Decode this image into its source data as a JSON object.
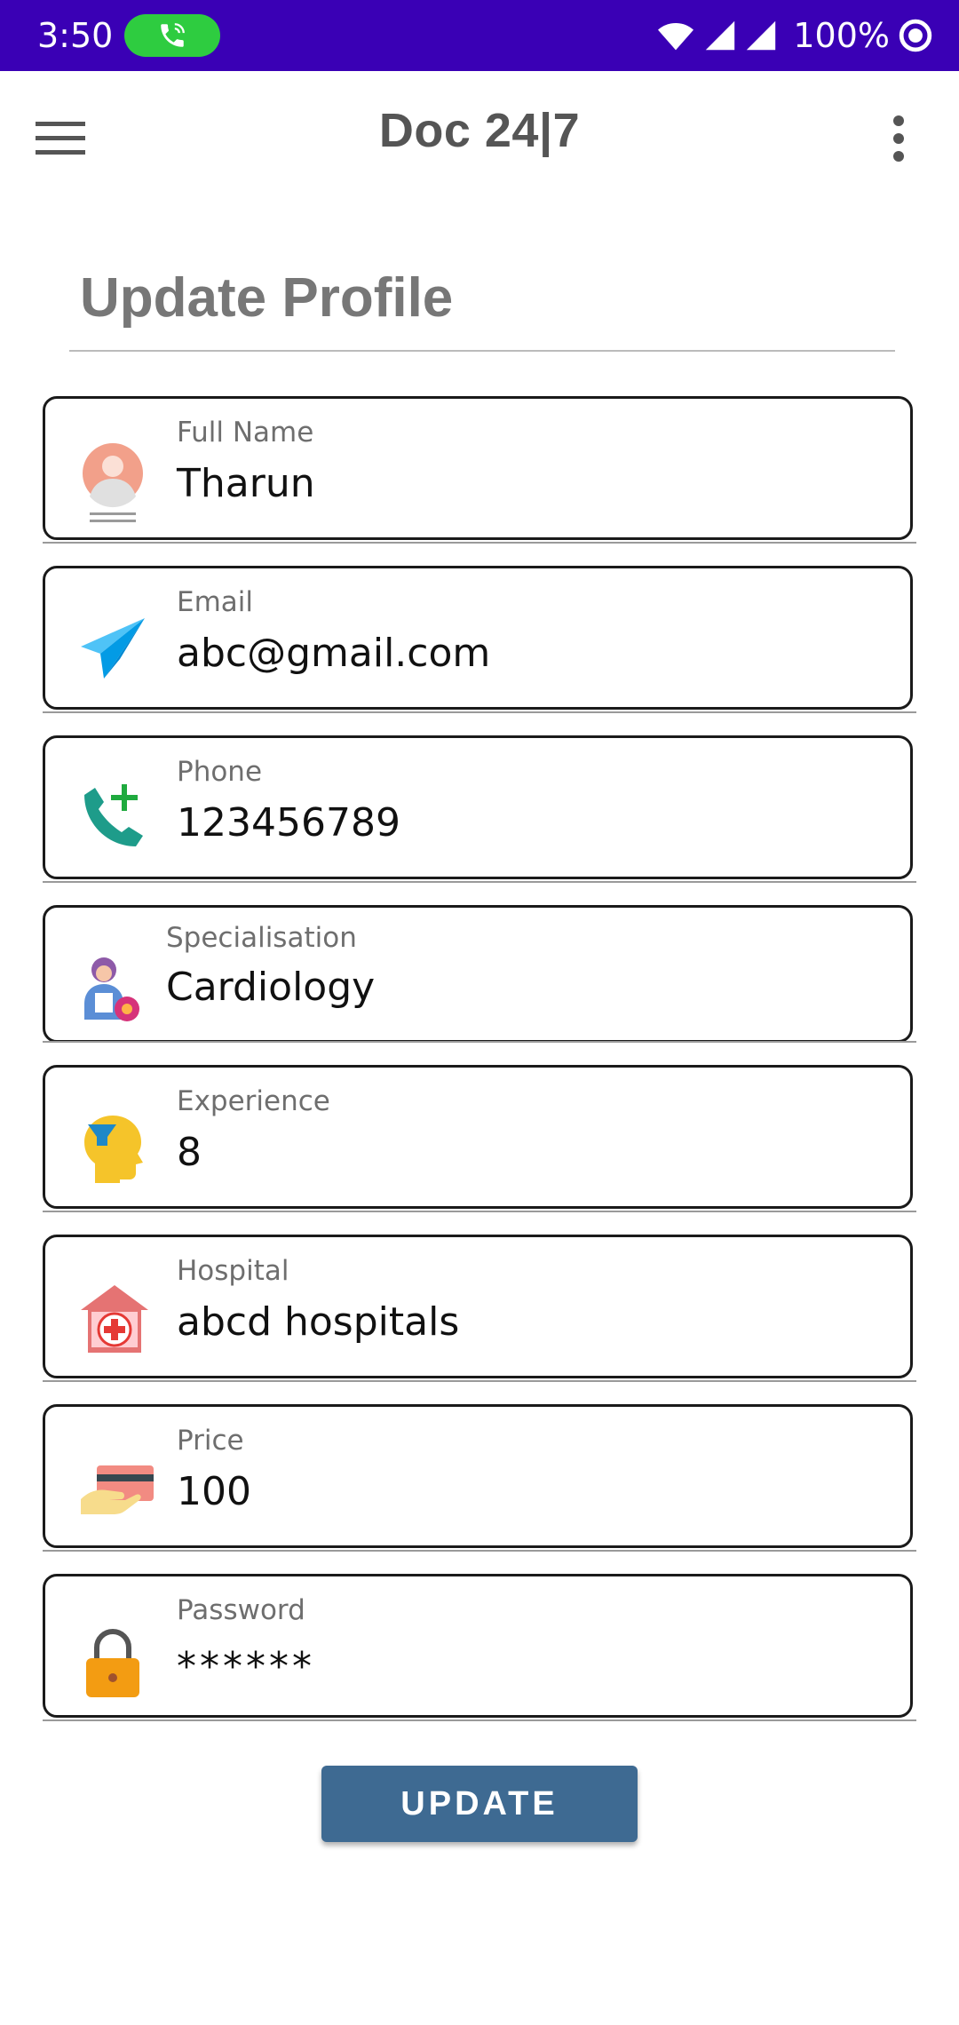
{
  "status_bar": {
    "time": "3:50",
    "battery": "100%",
    "icons": [
      "call-active-icon",
      "wifi-icon",
      "signal-icon",
      "signal-icon",
      "battery-saver-icon"
    ]
  },
  "app_bar": {
    "title": "Doc 24|7",
    "menu_icon": "hamburger-menu-icon",
    "more_icon": "more-vert-icon"
  },
  "page": {
    "title": "Update Profile"
  },
  "fields": [
    {
      "label": "Full Name",
      "value": "Tharun",
      "icon": "person-avatar-icon"
    },
    {
      "label": "Email",
      "value": "abc@gmail.com",
      "icon": "paper-plane-icon"
    },
    {
      "label": "Phone",
      "value": "123456789",
      "icon": "phone-add-icon"
    },
    {
      "label": "Specialisation",
      "value": "Cardiology",
      "icon": "doctor-specialist-icon"
    },
    {
      "label": "Experience",
      "value": "8",
      "icon": "head-experience-icon"
    },
    {
      "label": "Hospital",
      "value": "abcd hospitals",
      "icon": "hospital-icon"
    },
    {
      "label": "Price",
      "value": "100",
      "icon": "payment-card-icon"
    },
    {
      "label": "Password",
      "value": "******",
      "icon": "padlock-icon"
    }
  ],
  "update_button": {
    "label": "UPDATE"
  },
  "colors": {
    "status_bar": "#3a00b5",
    "call_pill": "#2ecc40",
    "button": "#3e6a92",
    "title_text": "#555555"
  }
}
